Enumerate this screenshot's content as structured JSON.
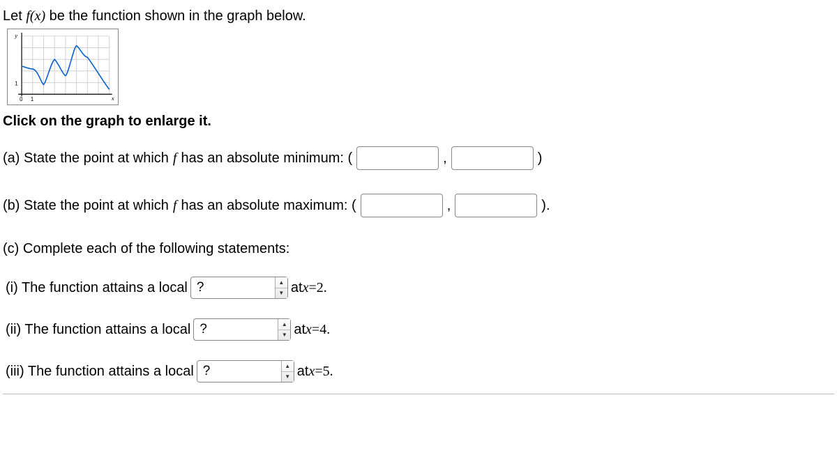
{
  "intro": {
    "prefix": "Let ",
    "fx": "f(x)",
    "suffix": " be the function shown in the graph below."
  },
  "enlarge_text": "Click on the graph to enlarge it.",
  "a": {
    "text": "(a) State the point at which ",
    "f": "f",
    "text2": " has an absolute minimum: (",
    "comma": " , ",
    "close": " )"
  },
  "b": {
    "text": "(b) State the point at which ",
    "f": "f",
    "text2": " has an absolute maximum: (",
    "comma": " , ",
    "close": " )."
  },
  "c": {
    "head": "(c) Complete each of the following statements:",
    "items": [
      {
        "prefix": "(i) The function attains a local ",
        "dd": "?",
        "suffix_pre": " at ",
        "x": "x",
        "eq": " = ",
        "val": "2."
      },
      {
        "prefix": "(ii) The function attains a local ",
        "dd": "?",
        "suffix_pre": " at ",
        "x": "x",
        "eq": " = ",
        "val": "4."
      },
      {
        "prefix": "(iii) The function attains a local ",
        "dd": "?",
        "suffix_pre": " at ",
        "x": "x",
        "eq": " = ",
        "val": "5."
      }
    ]
  },
  "chart_data": {
    "type": "line",
    "title": "",
    "xlabel": "x",
    "ylabel": "y",
    "xlim": [
      0,
      8
    ],
    "ylim": [
      0,
      5
    ],
    "x_ticks_labeled": [
      0,
      1
    ],
    "y_ticks_labeled": [
      1
    ],
    "grid": true,
    "series": [
      {
        "name": "f(x)",
        "x": [
          0,
          1,
          2,
          3,
          4,
          5,
          6,
          7,
          8
        ],
        "y": [
          2.4,
          2.2,
          0.8,
          3.0,
          1.6,
          4.2,
          3.2,
          2.0,
          0.4
        ]
      }
    ]
  }
}
